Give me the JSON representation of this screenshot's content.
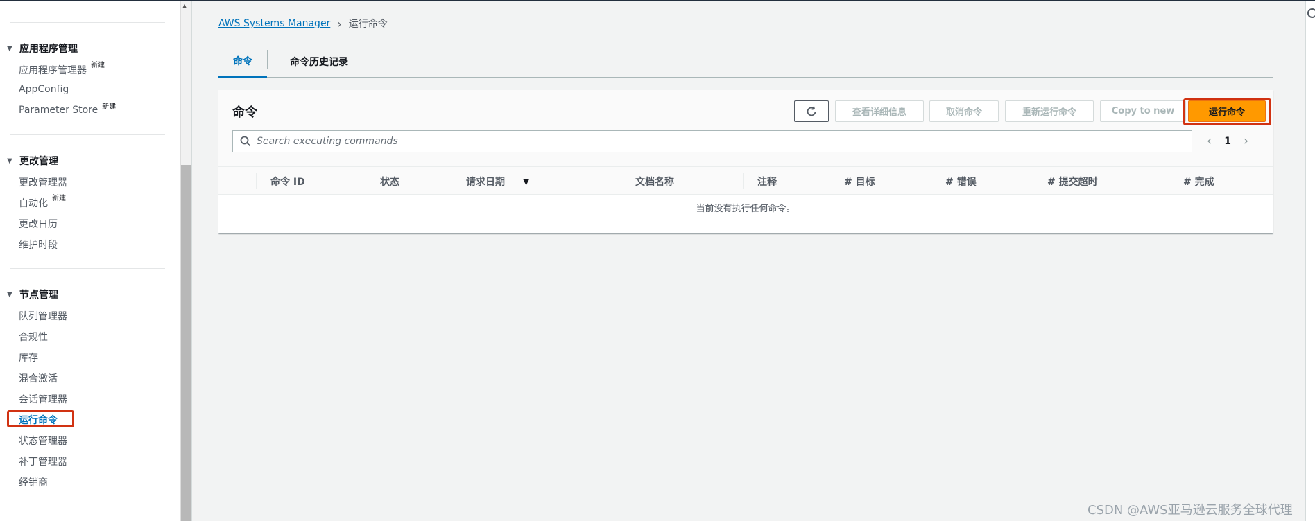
{
  "sidebar": {
    "sections": [
      {
        "title": "应用程序管理",
        "items": [
          {
            "label": "应用程序管理器",
            "tag": "新建"
          },
          {
            "label": "AppConfig",
            "tag": ""
          },
          {
            "label": "Parameter Store",
            "tag": "新建"
          }
        ]
      },
      {
        "title": "更改管理",
        "items": [
          {
            "label": "更改管理器",
            "tag": ""
          },
          {
            "label": "自动化",
            "tag": "新建"
          },
          {
            "label": "更改日历",
            "tag": ""
          },
          {
            "label": "维护时段",
            "tag": ""
          }
        ]
      },
      {
        "title": "节点管理",
        "items": [
          {
            "label": "队列管理器"
          },
          {
            "label": "合规性"
          },
          {
            "label": "库存"
          },
          {
            "label": "混合激活"
          },
          {
            "label": "会话管理器"
          },
          {
            "label": "运行命令"
          },
          {
            "label": "状态管理器"
          },
          {
            "label": "补丁管理器"
          },
          {
            "label": "经销商"
          }
        ]
      }
    ]
  },
  "breadcrumb": {
    "parent": "AWS Systems Manager",
    "current": "运行命令"
  },
  "tabs": [
    {
      "label": "命令"
    },
    {
      "label": "命令历史记录"
    }
  ],
  "panel": {
    "title": "命令",
    "buttons": {
      "view_details": "查看详细信息",
      "cancel": "取消命令",
      "rerun": "重新运行命令",
      "copy_to_new": "Copy to new",
      "run": "运行命令"
    },
    "search_placeholder": "Search executing commands",
    "page": "1",
    "columns": [
      "命令 ID",
      "状态",
      "请求日期",
      "文档名称",
      "注释",
      "# 目标",
      "# 错误",
      "# 提交超时",
      "# 完成"
    ],
    "empty_message": "当前没有执行任何命令。"
  },
  "watermark": "CSDN @AWS亚马逊云服务全球代理",
  "colors": {
    "accent": "#0073bb",
    "primary_button": "#ff9900",
    "highlight": "#d13212"
  }
}
